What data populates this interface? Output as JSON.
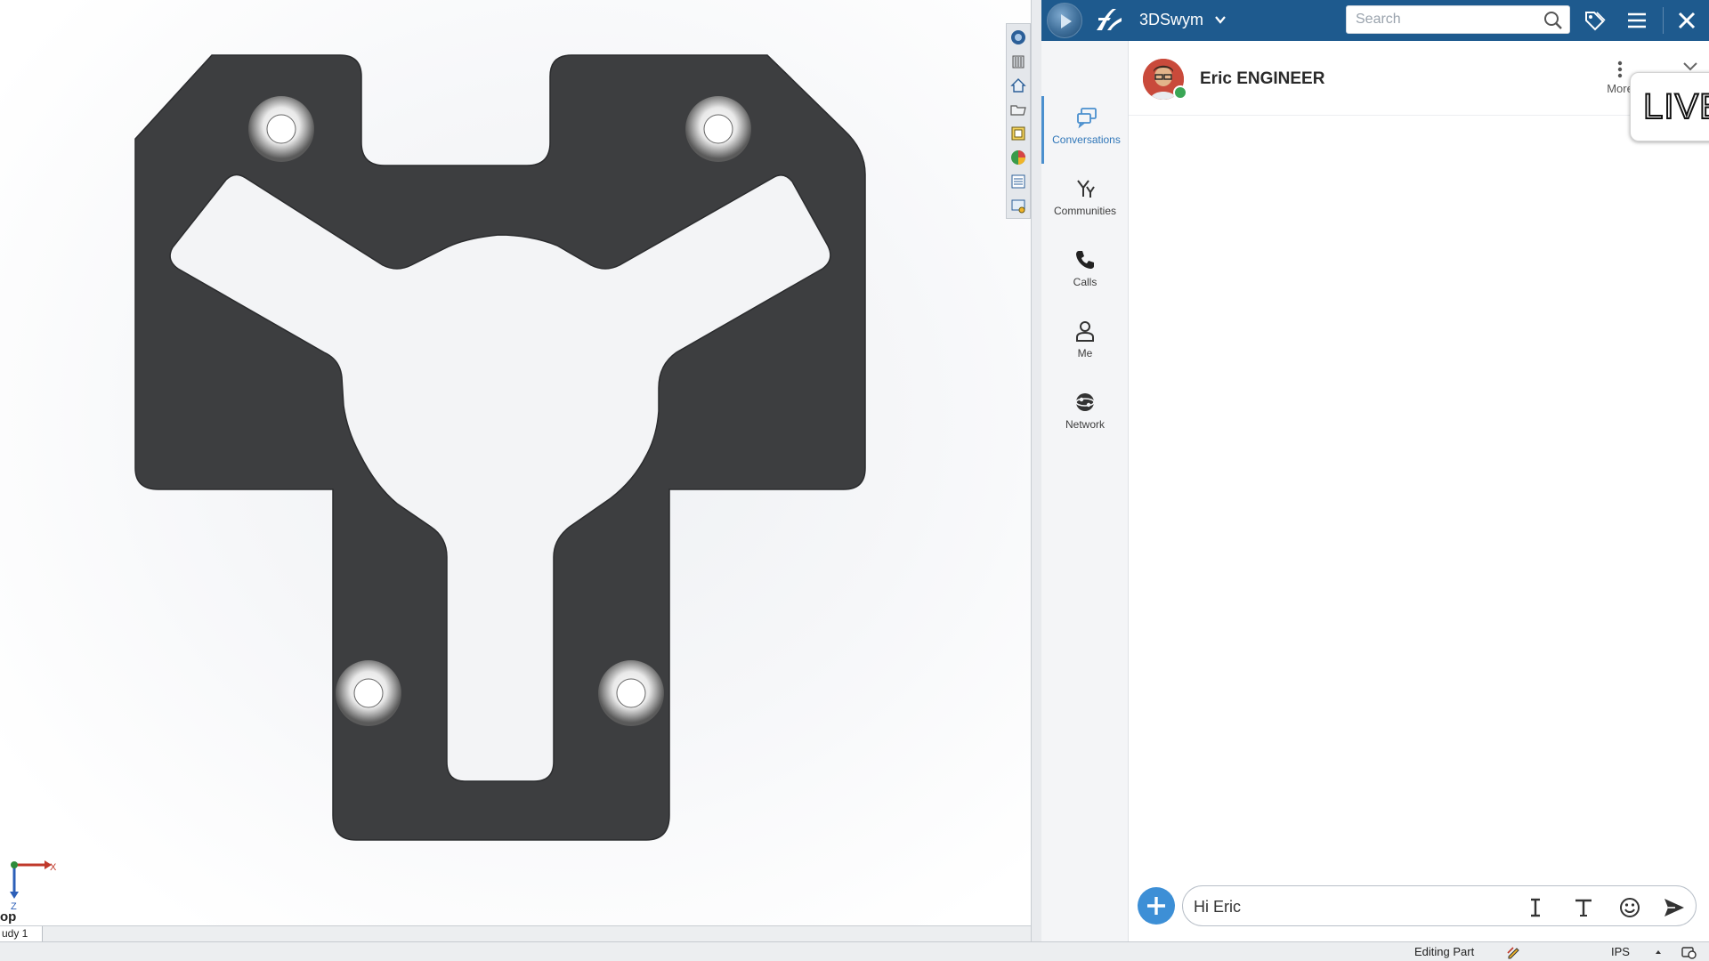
{
  "cad": {
    "view_label": "op",
    "study_tab": "udy 1",
    "triad": {
      "x_label": "X",
      "z_label": "Z"
    },
    "view_toolbar": [
      "view-orientation-icon",
      "display-style-icon",
      "home-view-icon",
      "open-folder-icon",
      "section-view-icon",
      "appearance-icon",
      "view-list-icon",
      "scene-settings-icon"
    ]
  },
  "app": {
    "name": "3DSwym",
    "search_placeholder": "Search",
    "colors": {
      "topbar": "#1e5a8e",
      "accent": "#3d8fd6",
      "presence": "#3aa655"
    }
  },
  "nav": {
    "items": [
      {
        "label": "Conversations",
        "icon": "conversations-icon",
        "active": true
      },
      {
        "label": "Communities",
        "icon": "communities-icon",
        "active": false
      },
      {
        "label": "Calls",
        "icon": "phone-icon",
        "active": false
      },
      {
        "label": "Me",
        "icon": "person-icon",
        "active": false
      },
      {
        "label": "Network",
        "icon": "network-icon",
        "active": false
      }
    ]
  },
  "conversation": {
    "contact_name": "Eric ENGINEER",
    "more_label": "More",
    "live_badge": "LIVE",
    "message_draft": "Hi Eric"
  },
  "statusbar": {
    "editing": "Editing Part",
    "units": "IPS"
  }
}
